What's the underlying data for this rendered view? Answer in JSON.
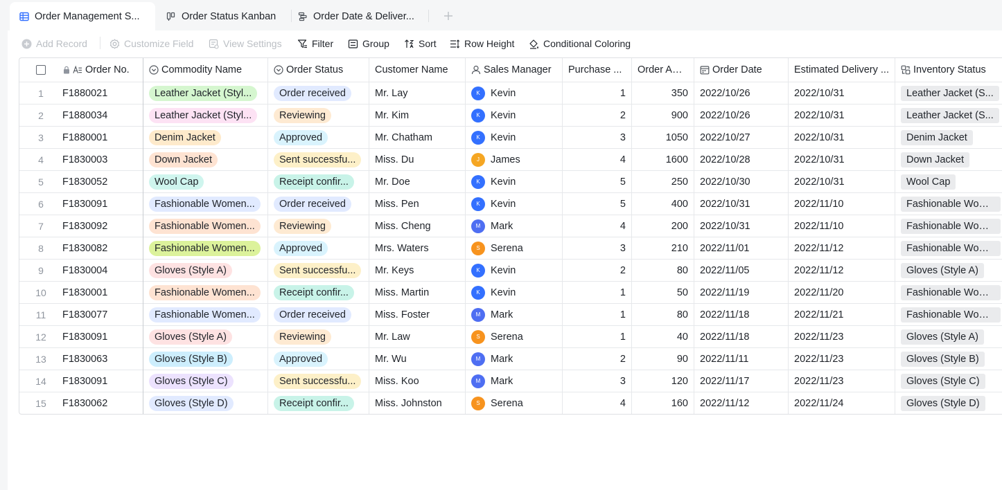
{
  "tabs": [
    {
      "label": "Order Management S...",
      "icon": "grid-table-icon",
      "active": true
    },
    {
      "label": "Order Status Kanban",
      "icon": "kanban-icon",
      "active": false
    },
    {
      "label": "Order Date & Deliver...",
      "icon": "gantt-icon",
      "active": false
    }
  ],
  "toolbar": {
    "add_record": "Add Record",
    "customize_field": "Customize Field",
    "view_settings": "View Settings",
    "filter": "Filter",
    "group": "Group",
    "sort": "Sort",
    "row_height": "Row Height",
    "conditional_coloring": "Conditional Coloring"
  },
  "columns": {
    "order_no": "Order No.",
    "commodity": "Commodity Name",
    "status": "Order Status",
    "customer": "Customer Name",
    "manager": "Sales Manager",
    "purchase": "Purchase ...",
    "amount": "Order Am...",
    "order_date": "Order Date",
    "delivery": "Estimated Delivery ...",
    "inventory": "Inventory Status"
  },
  "colors": {
    "manager": {
      "Kevin": "#3370ff",
      "James": "#f5a623",
      "Mark": "#4e6ef2",
      "Serena": "#f7931e"
    }
  },
  "rows": [
    {
      "idx": "1",
      "order_no": "F1880021",
      "commodity": "Leather Jacket (Styl...",
      "commodity_color": "#d5f6cf",
      "status": "Order received",
      "status_color": "#e1eaff",
      "customer": "Mr. Lay",
      "manager": "Kevin",
      "manager_initial": "K",
      "purchase": "1",
      "amount": "350",
      "order_date": "2022/10/26",
      "delivery": "2022/10/31",
      "inventory": "Leather Jacket (S..."
    },
    {
      "idx": "2",
      "order_no": "F1880034",
      "commodity": "Leather Jacket (Styl...",
      "commodity_color": "#fde2f4",
      "status": "Reviewing",
      "status_color": "#feead2",
      "customer": "Mr. Kim",
      "manager": "Kevin",
      "manager_initial": "K",
      "purchase": "2",
      "amount": "900",
      "order_date": "2022/10/26",
      "delivery": "2022/10/31",
      "inventory": "Leather Jacket (S..."
    },
    {
      "idx": "3",
      "order_no": "F1880001",
      "commodity": "Denim Jacket",
      "commodity_color": "#feeacb",
      "status": "Approved",
      "status_color": "#d9f3fd",
      "customer": "Mr. Chatham",
      "manager": "Kevin",
      "manager_initial": "K",
      "purchase": "3",
      "amount": "1050",
      "order_date": "2022/10/27",
      "delivery": "2022/10/31",
      "inventory": "Denim Jacket"
    },
    {
      "idx": "4",
      "order_no": "F1830003",
      "commodity": "Down Jacket",
      "commodity_color": "#fee3d2",
      "status": "Sent successfu...",
      "status_color": "#fdf0c8",
      "customer": "Miss. Du",
      "manager": "James",
      "manager_initial": "J",
      "purchase": "4",
      "amount": "1600",
      "order_date": "2022/10/28",
      "delivery": "2022/10/31",
      "inventory": "Down Jacket"
    },
    {
      "idx": "5",
      "order_no": "F1830052",
      "commodity": "Wool Cap",
      "commodity_color": "#cff5ee",
      "status": "Receipt confir...",
      "status_color": "#c8f3e8",
      "customer": "Mr. Doe",
      "manager": "Kevin",
      "manager_initial": "K",
      "purchase": "5",
      "amount": "250",
      "order_date": "2022/10/30",
      "delivery": "2022/10/31",
      "inventory": "Wool Cap"
    },
    {
      "idx": "6",
      "order_no": "F1830091",
      "commodity": "Fashionable Women...",
      "commodity_color": "#e1eaff",
      "status": "Order received",
      "status_color": "#e1eaff",
      "customer": "Miss. Pen",
      "manager": "Kevin",
      "manager_initial": "K",
      "purchase": "5",
      "amount": "400",
      "order_date": "2022/10/31",
      "delivery": "2022/11/10",
      "inventory": "Fashionable Wom..."
    },
    {
      "idx": "7",
      "order_no": "F1830092",
      "commodity": "Fashionable Women...",
      "commodity_color": "#fee3d2",
      "status": "Reviewing",
      "status_color": "#feead2",
      "customer": "Miss. Cheng",
      "manager": "Mark",
      "manager_initial": "M",
      "purchase": "4",
      "amount": "200",
      "order_date": "2022/10/31",
      "delivery": "2022/11/10",
      "inventory": "Fashionable Wom..."
    },
    {
      "idx": "8",
      "order_no": "F1830082",
      "commodity": "Fashionable Women...",
      "commodity_color": "#dcf29b",
      "status": "Approved",
      "status_color": "#d9f3fd",
      "customer": "Mrs. Waters",
      "manager": "Serena",
      "manager_initial": "S",
      "purchase": "3",
      "amount": "210",
      "order_date": "2022/11/01",
      "delivery": "2022/11/12",
      "inventory": "Fashionable Wom..."
    },
    {
      "idx": "9",
      "order_no": "F1830004",
      "commodity": "Gloves (Style A)",
      "commodity_color": "#fee2e2",
      "status": "Sent successfu...",
      "status_color": "#fdf0c8",
      "customer": "Mr. Keys",
      "manager": "Kevin",
      "manager_initial": "K",
      "purchase": "2",
      "amount": "80",
      "order_date": "2022/11/05",
      "delivery": "2022/11/12",
      "inventory": "Gloves (Style A)"
    },
    {
      "idx": "10",
      "order_no": "F1830001",
      "commodity": "Fashionable Women...",
      "commodity_color": "#fee3d2",
      "status": "Receipt confir...",
      "status_color": "#c8f3e8",
      "customer": "Miss. Martin",
      "manager": "Kevin",
      "manager_initial": "K",
      "purchase": "1",
      "amount": "50",
      "order_date": "2022/11/19",
      "delivery": "2022/11/20",
      "inventory": "Fashionable Wom..."
    },
    {
      "idx": "11",
      "order_no": "F1830077",
      "commodity": "Fashionable Women...",
      "commodity_color": "#e1eaff",
      "status": "Order received",
      "status_color": "#e1eaff",
      "customer": "Miss. Foster",
      "manager": "Mark",
      "manager_initial": "M",
      "purchase": "1",
      "amount": "80",
      "order_date": "2022/11/18",
      "delivery": "2022/11/21",
      "inventory": "Fashionable Wom..."
    },
    {
      "idx": "12",
      "order_no": "F1830091",
      "commodity": "Gloves (Style A)",
      "commodity_color": "#fee2e2",
      "status": "Reviewing",
      "status_color": "#feead2",
      "customer": "Mr. Law",
      "manager": "Serena",
      "manager_initial": "S",
      "purchase": "1",
      "amount": "40",
      "order_date": "2022/11/18",
      "delivery": "2022/11/23",
      "inventory": "Gloves (Style A)"
    },
    {
      "idx": "13",
      "order_no": "F1830063",
      "commodity": "Gloves (Style B)",
      "commodity_color": "#cdeefd",
      "status": "Approved",
      "status_color": "#d9f3fd",
      "customer": "Mr. Wu",
      "manager": "Mark",
      "manager_initial": "M",
      "purchase": "2",
      "amount": "90",
      "order_date": "2022/11/11",
      "delivery": "2022/11/23",
      "inventory": "Gloves (Style B)"
    },
    {
      "idx": "14",
      "order_no": "F1830091",
      "commodity": "Gloves (Style C)",
      "commodity_color": "#ece2fe",
      "status": "Sent successfu...",
      "status_color": "#fdf0c8",
      "customer": "Miss. Koo",
      "manager": "Mark",
      "manager_initial": "M",
      "purchase": "3",
      "amount": "120",
      "order_date": "2022/11/17",
      "delivery": "2022/11/23",
      "inventory": "Gloves (Style C)"
    },
    {
      "idx": "15",
      "order_no": "F1830062",
      "commodity": "Gloves (Style D)",
      "commodity_color": "#e1eaff",
      "status": "Receipt confir...",
      "status_color": "#c8f3e8",
      "customer": "Miss. Johnston",
      "manager": "Serena",
      "manager_initial": "S",
      "purchase": "4",
      "amount": "160",
      "order_date": "2022/11/12",
      "delivery": "2022/11/24",
      "inventory": "Gloves (Style D)"
    }
  ]
}
